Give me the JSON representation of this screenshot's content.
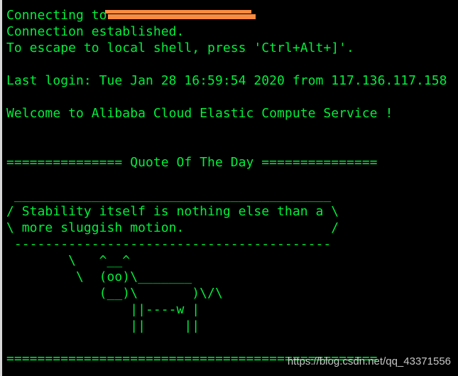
{
  "terminal": {
    "lines": [
      "Connecting to",
      "Connection established.",
      "To escape to local shell, press 'Ctrl+Alt+]'.",
      "",
      "Last login: Tue Jan 28 16:59:54 2020 from 117.136.117.158",
      "",
      "Welcome to Alibaba Cloud Elastic Compute Service !",
      "",
      "",
      "=============== Quote Of The Day ===============",
      "",
      " _________________________________________",
      "/ Stability itself is nothing else than a \\",
      "\\ more sluggish motion.                   /",
      " -----------------------------------------",
      "        \\   ^__^",
      "         \\  (oo)\\_______",
      "            (__)\\       )\\/\\",
      "                ||----w |",
      "                ||     ||",
      "",
      "================================================"
    ],
    "text_color": "#00ef3c",
    "background": "#000000"
  },
  "redaction_color": "#f98b40",
  "watermark": "https://blog.csdn.net/qq_43371556"
}
